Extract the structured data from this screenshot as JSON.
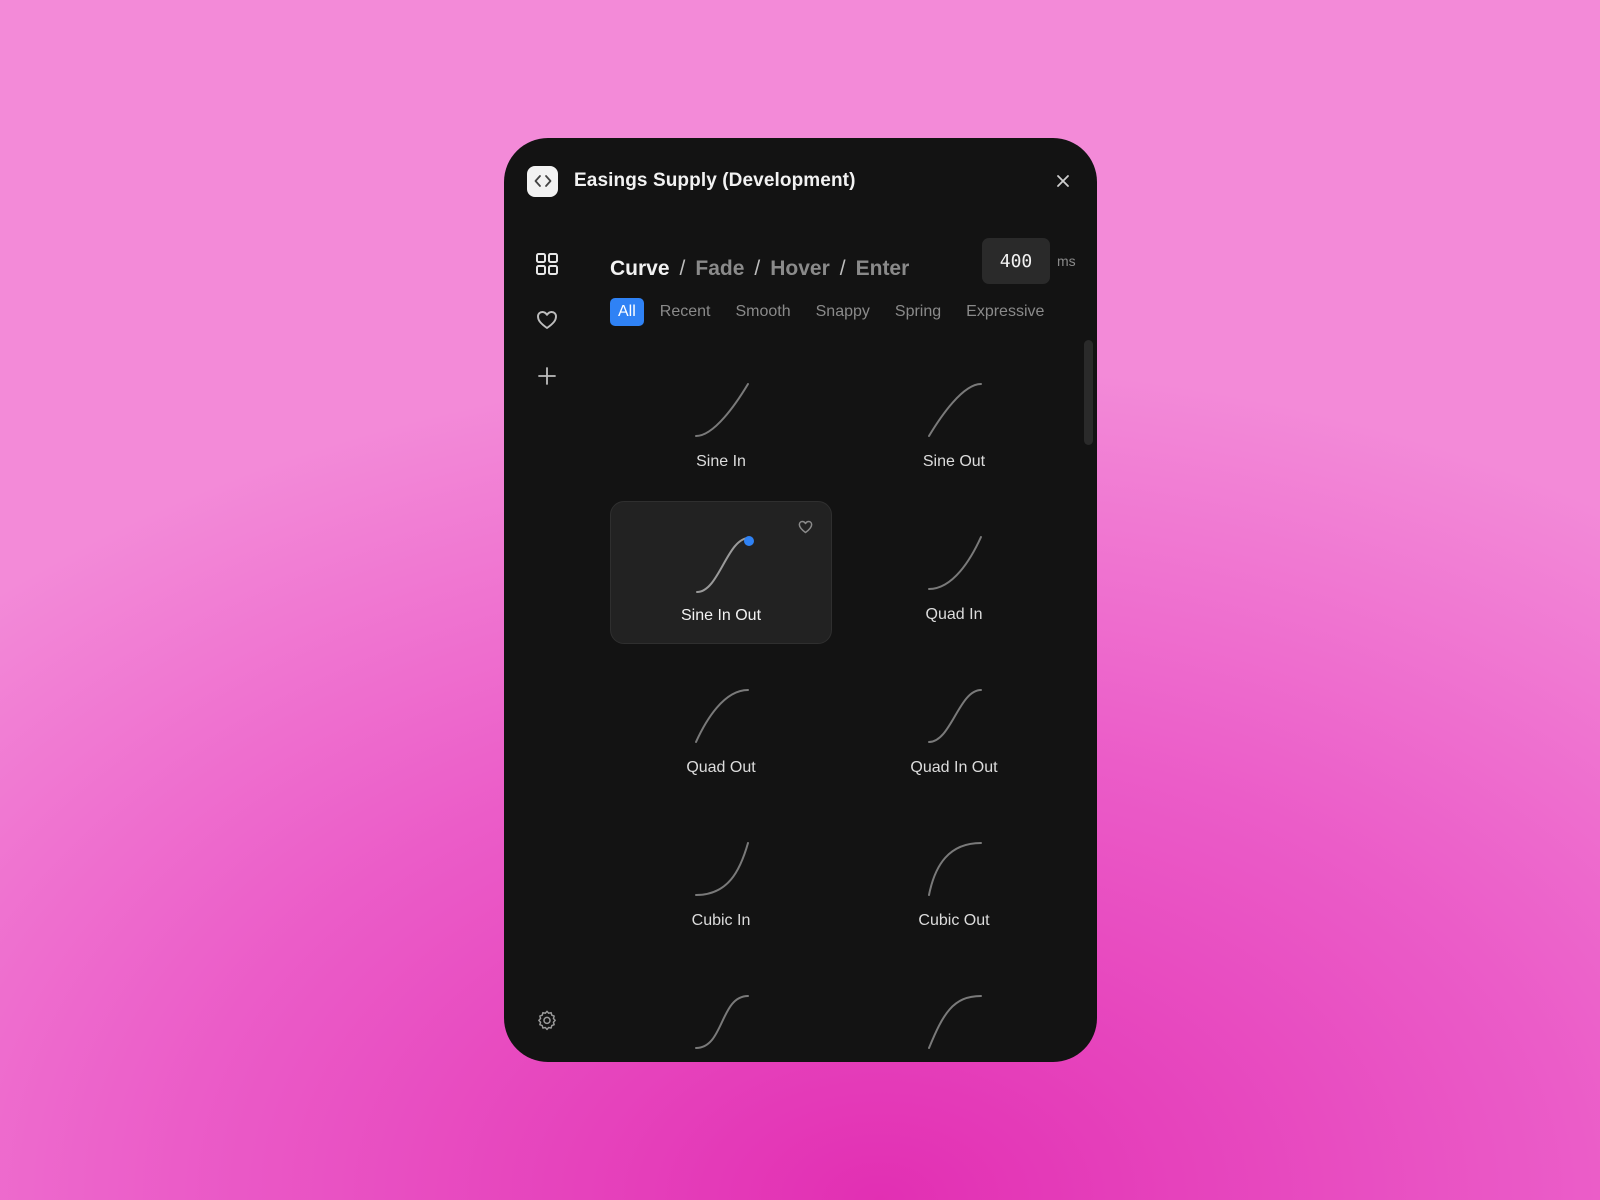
{
  "app": {
    "title": "Easings Supply (Development)"
  },
  "breadcrumb": [
    {
      "label": "Curve",
      "active": true
    },
    {
      "label": "Fade",
      "active": false
    },
    {
      "label": "Hover",
      "active": false
    },
    {
      "label": "Enter",
      "active": false
    }
  ],
  "breadcrumb_separator": "/",
  "duration": {
    "value": "400",
    "unit": "ms"
  },
  "filters": [
    "All",
    "Recent",
    "Smooth",
    "Snappy",
    "Spring",
    "Expressive"
  ],
  "active_filter": "All",
  "accent_color": "#2f82f5",
  "easings": [
    {
      "label": "Sine In",
      "curve": "sine-in"
    },
    {
      "label": "Sine Out",
      "curve": "sine-out"
    },
    {
      "label": "Sine In Out",
      "curve": "sine-in-out",
      "selected": true
    },
    {
      "label": "Quad In",
      "curve": "quad-in"
    },
    {
      "label": "Quad Out",
      "curve": "quad-out"
    },
    {
      "label": "Quad In Out",
      "curve": "quad-in-out"
    },
    {
      "label": "Cubic In",
      "curve": "cubic-in"
    },
    {
      "label": "Cubic Out",
      "curve": "cubic-out"
    },
    {
      "label": "",
      "curve": "cubic-in-out"
    },
    {
      "label": "",
      "curve": "quart-out"
    }
  ],
  "icons": {
    "app": "code-brackets-icon",
    "close": "close-icon",
    "grid": "grid-icon",
    "favorites": "heart-icon",
    "add": "plus-icon",
    "settings": "gear-icon",
    "favorite_toggle": "heart-outline-icon"
  }
}
